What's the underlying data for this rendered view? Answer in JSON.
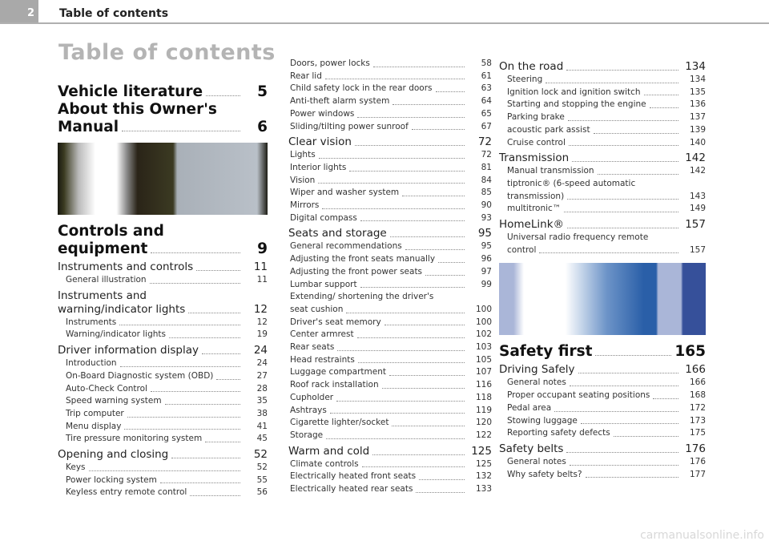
{
  "header": {
    "page_number": "2",
    "running_title": "Table of contents"
  },
  "title": "Table of contents",
  "columns": [
    [
      {
        "level": "m",
        "text": "Vehicle literature",
        "page": "5"
      },
      {
        "level": "m",
        "text": "About this Owner's",
        "text2": "Manual",
        "page": "6"
      },
      {
        "level": "img",
        "id": "img1"
      },
      {
        "level": "m",
        "text": "Controls and",
        "text2": "equipment",
        "page": "9"
      },
      {
        "level": "h",
        "text": "Instruments and controls",
        "page": "11"
      },
      {
        "level": "s",
        "text": "General illustration",
        "page": "11"
      },
      {
        "level": "h",
        "text": "Instruments and",
        "text2": "warning/indicator lights",
        "page": "12"
      },
      {
        "level": "s",
        "text": "Instruments",
        "page": "12"
      },
      {
        "level": "s",
        "text": "Warning/indicator lights",
        "page": "19"
      },
      {
        "level": "h",
        "text": "Driver information display",
        "page": "24"
      },
      {
        "level": "s",
        "text": "Introduction",
        "page": "24"
      },
      {
        "level": "s",
        "text": "On-Board Diagnostic system (OBD)",
        "page": "27"
      },
      {
        "level": "s",
        "text": "Auto-Check Control",
        "page": "28"
      },
      {
        "level": "s",
        "text": "Speed warning system",
        "page": "35"
      },
      {
        "level": "s",
        "text": "Trip computer",
        "page": "38"
      },
      {
        "level": "s",
        "text": "Menu display",
        "page": "41"
      },
      {
        "level": "s",
        "text": "Tire pressure monitoring system",
        "page": "45"
      },
      {
        "level": "h",
        "text": "Opening and closing",
        "page": "52"
      },
      {
        "level": "s",
        "text": "Keys",
        "page": "52"
      },
      {
        "level": "s",
        "text": "Power locking system",
        "page": "55"
      },
      {
        "level": "s",
        "text": "Keyless entry remote control",
        "page": "56"
      }
    ],
    [
      {
        "level": "s",
        "text": "Doors, power locks",
        "page": "58"
      },
      {
        "level": "s",
        "text": "Rear lid",
        "page": "61"
      },
      {
        "level": "s",
        "text": "Child safety lock in the rear doors",
        "page": "63"
      },
      {
        "level": "s",
        "text": "Anti-theft alarm system",
        "page": "64"
      },
      {
        "level": "s",
        "text": "Power windows",
        "page": "65"
      },
      {
        "level": "s",
        "text": "Sliding/tilting power sunroof",
        "page": "67"
      },
      {
        "level": "h",
        "text": "Clear vision",
        "page": "72"
      },
      {
        "level": "s",
        "text": "Lights",
        "page": "72"
      },
      {
        "level": "s",
        "text": "Interior lights",
        "page": "81"
      },
      {
        "level": "s",
        "text": "Vision",
        "page": "84"
      },
      {
        "level": "s",
        "text": "Wiper and washer system",
        "page": "85"
      },
      {
        "level": "s",
        "text": "Mirrors",
        "page": "90"
      },
      {
        "level": "s",
        "text": "Digital compass",
        "page": "93"
      },
      {
        "level": "h",
        "text": "Seats and storage",
        "page": "95"
      },
      {
        "level": "s",
        "text": "General recommendations",
        "page": "95"
      },
      {
        "level": "s",
        "text": "Adjusting the front seats manually",
        "page": "96"
      },
      {
        "level": "s",
        "text": "Adjusting the front power seats",
        "page": "97"
      },
      {
        "level": "s",
        "text": "Lumbar support",
        "page": "99"
      },
      {
        "level": "s",
        "text": "Extending/ shortening the driver's",
        "text2": "seat cushion",
        "page": "100"
      },
      {
        "level": "s",
        "text": "Driver's seat memory",
        "page": "100"
      },
      {
        "level": "s",
        "text": "Center armrest",
        "page": "102"
      },
      {
        "level": "s",
        "text": "Rear seats",
        "page": "103"
      },
      {
        "level": "s",
        "text": "Head restraints",
        "page": "105"
      },
      {
        "level": "s",
        "text": "Luggage compartment",
        "page": "107"
      },
      {
        "level": "s",
        "text": "Roof rack installation",
        "page": "116"
      },
      {
        "level": "s",
        "text": "Cupholder",
        "page": "118"
      },
      {
        "level": "s",
        "text": "Ashtrays",
        "page": "119"
      },
      {
        "level": "s",
        "text": "Cigarette lighter/socket",
        "page": "120"
      },
      {
        "level": "s",
        "text": "Storage",
        "page": "122"
      },
      {
        "level": "h",
        "text": "Warm and cold",
        "page": "125"
      },
      {
        "level": "s",
        "text": "Climate controls",
        "page": "125"
      },
      {
        "level": "s",
        "text": "Electrically heated front seats",
        "page": "132"
      },
      {
        "level": "s",
        "text": "Electrically heated rear seats",
        "page": "133"
      }
    ],
    [
      {
        "level": "h",
        "text": "On the road",
        "page": "134"
      },
      {
        "level": "s",
        "text": "Steering",
        "page": "134"
      },
      {
        "level": "s",
        "text": "Ignition lock and ignition switch",
        "page": "135"
      },
      {
        "level": "s",
        "text": "Starting and stopping the engine",
        "page": "136"
      },
      {
        "level": "s",
        "text": "Parking brake",
        "page": "137"
      },
      {
        "level": "s",
        "text": "acoustic park assist",
        "page": "139"
      },
      {
        "level": "s",
        "text": "Cruise control",
        "page": "140"
      },
      {
        "level": "h",
        "text": "Transmission",
        "page": "142"
      },
      {
        "level": "s",
        "text": "Manual transmission",
        "page": "142"
      },
      {
        "level": "s",
        "text": "tiptronic® (6-speed automatic",
        "text2": "transmission)",
        "page": "143"
      },
      {
        "level": "s",
        "text": "multitronic™",
        "page": "149"
      },
      {
        "level": "h",
        "text": "HomeLink®",
        "page": "157"
      },
      {
        "level": "s",
        "text": "Universal radio frequency remote",
        "text2": "control",
        "page": "157"
      },
      {
        "level": "img",
        "id": "img2"
      },
      {
        "level": "m",
        "text": "Safety first",
        "page": "165"
      },
      {
        "level": "h",
        "text": "Driving Safely",
        "page": "166"
      },
      {
        "level": "s",
        "text": "General notes",
        "page": "166"
      },
      {
        "level": "s",
        "text": "Proper occupant seating positions",
        "page": "168"
      },
      {
        "level": "s",
        "text": "Pedal area",
        "page": "172"
      },
      {
        "level": "s",
        "text": "Stowing luggage",
        "page": "173"
      },
      {
        "level": "s",
        "text": "Reporting safety defects",
        "page": "175"
      },
      {
        "level": "h",
        "text": "Safety belts",
        "page": "176"
      },
      {
        "level": "s",
        "text": "General notes",
        "page": "176"
      },
      {
        "level": "s",
        "text": "Why safety belts?",
        "page": "177"
      }
    ]
  ],
  "watermark": "carmanualsonline.info"
}
